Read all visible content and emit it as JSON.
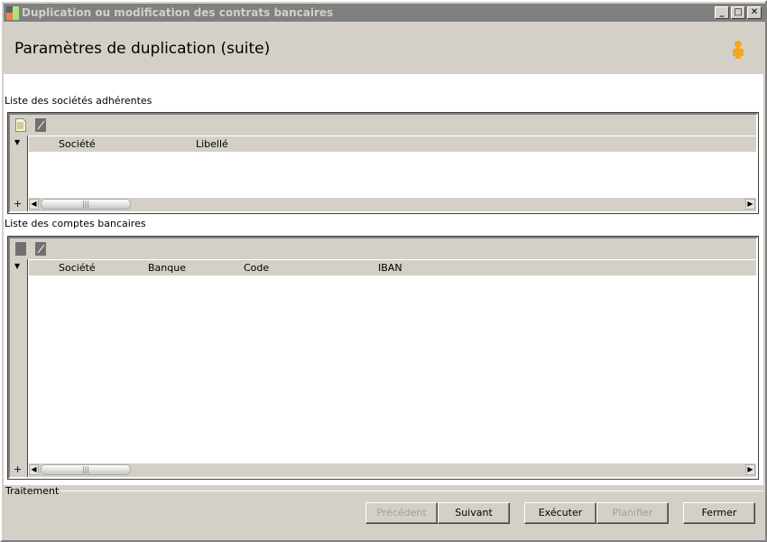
{
  "window": {
    "title": "Duplication ou modification des contrats bancaires",
    "minimize": "_",
    "maximize": "□",
    "close": "✕"
  },
  "header": {
    "title": "Paramètres de duplication (suite)",
    "icon": "user-icon"
  },
  "societes": {
    "label": "Liste des sociétés adhérentes",
    "columns": [
      "Société",
      "Libellé"
    ],
    "rows": []
  },
  "comptes": {
    "label": "Liste des comptes bancaires",
    "columns": [
      "Société",
      "Banque",
      "Code",
      "IBAN"
    ],
    "rows": []
  },
  "grid": {
    "expand": "▼",
    "add": "+",
    "scroll_left": "◀",
    "scroll_right": "▶",
    "thumb": "|||"
  },
  "footer": {
    "label": "Traitement",
    "buttons": {
      "prev": "Précédent",
      "next": "Suivant",
      "exec": "Exécuter",
      "plan": "Planifier",
      "close": "Fermer"
    }
  }
}
